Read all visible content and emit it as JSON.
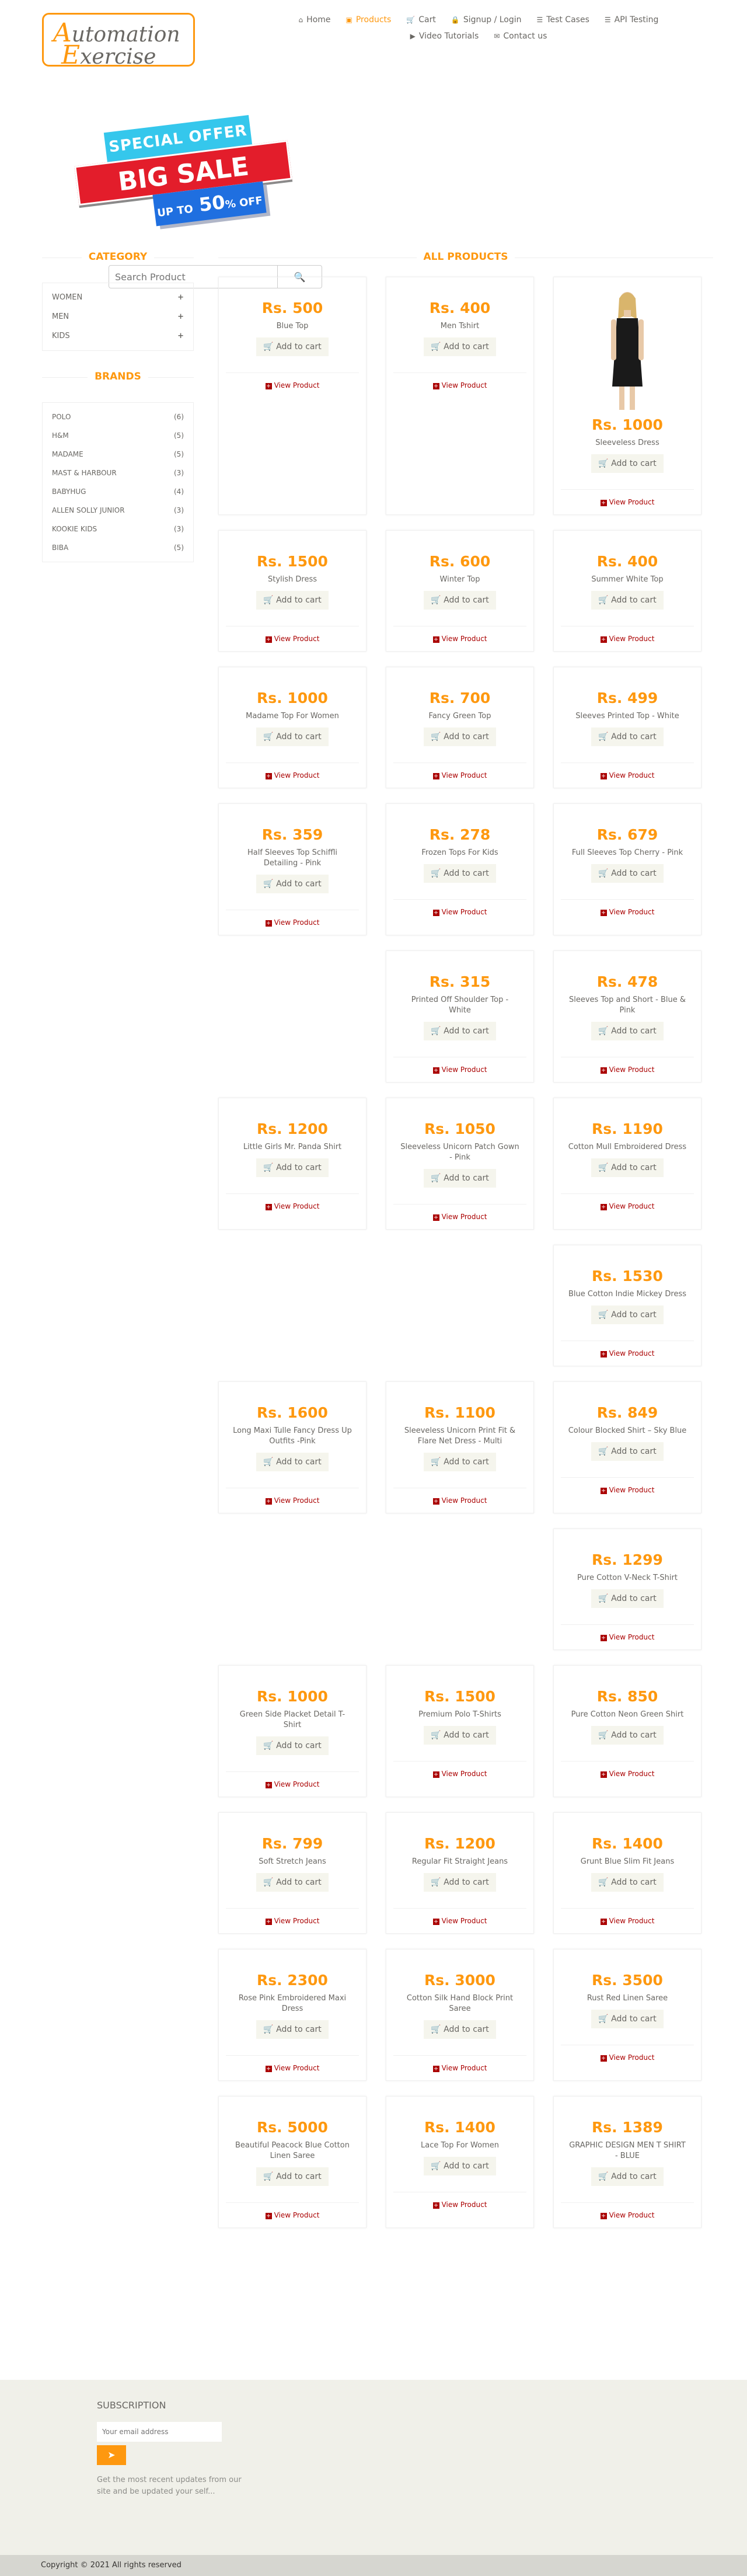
{
  "logo": {
    "word1_cap": "A",
    "word1_rest": "utomation",
    "word2_cap": "E",
    "word2_rest": "xercise"
  },
  "nav": [
    {
      "label": "Home",
      "icon": "home-icon",
      "glyph": "⌂"
    },
    {
      "label": "Products",
      "icon": "products-icon",
      "glyph": "▣",
      "active": true
    },
    {
      "label": "Cart",
      "icon": "cart-icon",
      "glyph": "🛒"
    },
    {
      "label": "Signup / Login",
      "icon": "lock-icon",
      "glyph": "🔒"
    },
    {
      "label": "Test Cases",
      "icon": "list-icon",
      "glyph": "☰"
    },
    {
      "label": "API Testing",
      "icon": "list-icon",
      "glyph": "☰"
    },
    {
      "label": "Video Tutorials",
      "icon": "youtube-icon",
      "glyph": "▶"
    },
    {
      "label": "Contact us",
      "icon": "envelope-icon",
      "glyph": "✉"
    }
  ],
  "banner": {
    "line1": "SPECIAL OFFER",
    "line2": "BIG SALE",
    "line3a": "UP TO",
    "line3b": "50",
    "line3c": "% OFF"
  },
  "search": {
    "placeholder": "Search Product",
    "button_icon": "search-icon"
  },
  "sidebar": {
    "category_title": "CATEGORY",
    "categories": [
      "WOMEN",
      "MEN",
      "KIDS"
    ],
    "brands_title": "BRANDS",
    "brands": [
      {
        "name": "POLO",
        "count": "(6)"
      },
      {
        "name": "H&M",
        "count": "(5)"
      },
      {
        "name": "MADAME",
        "count": "(5)"
      },
      {
        "name": "MAST & HARBOUR",
        "count": "(3)"
      },
      {
        "name": "BABYHUG",
        "count": "(4)"
      },
      {
        "name": "ALLEN SOLLY JUNIOR",
        "count": "(3)"
      },
      {
        "name": "KOOKIE KIDS",
        "count": "(3)"
      },
      {
        "name": "BIBA",
        "count": "(5)"
      }
    ]
  },
  "products_title": "ALL PRODUCTS",
  "add_to_cart": "Add to cart",
  "view_product": "View Product",
  "products": [
    {
      "price": "Rs. 500",
      "name": "Blue Top"
    },
    {
      "price": "Rs. 400",
      "name": "Men Tshirt"
    },
    {
      "price": "Rs. 1000",
      "name": "Sleeveless Dress",
      "image": true
    },
    {
      "price": "Rs. 1500",
      "name": "Stylish Dress"
    },
    {
      "price": "Rs. 600",
      "name": "Winter Top"
    },
    {
      "price": "Rs. 400",
      "name": "Summer White Top"
    },
    {
      "price": "Rs. 1000",
      "name": "Madame Top For Women"
    },
    {
      "price": "Rs. 700",
      "name": "Fancy Green Top"
    },
    {
      "price": "Rs. 499",
      "name": "Sleeves Printed Top - White"
    },
    {
      "price": "Rs. 359",
      "name": "Half Sleeves Top Schiffli Detailing - Pink"
    },
    {
      "price": "Rs. 278",
      "name": "Frozen Tops For Kids"
    },
    {
      "price": "Rs. 679",
      "name": "Full Sleeves Top Cherry - Pink"
    },
    {
      "blank": true
    },
    {
      "price": "Rs. 315",
      "name": "Printed Off Shoulder Top - White"
    },
    {
      "price": "Rs. 478",
      "name": "Sleeves Top and Short - Blue & Pink"
    },
    {
      "price": "Rs. 1200",
      "name": "Little Girls Mr. Panda Shirt"
    },
    {
      "price": "Rs. 1050",
      "name": "Sleeveless Unicorn Patch Gown - Pink"
    },
    {
      "price": "Rs. 1190",
      "name": "Cotton Mull Embroidered Dress"
    },
    {
      "blank": true
    },
    {
      "blank": true
    },
    {
      "price": "Rs. 1530",
      "name": "Blue Cotton Indie Mickey Dress"
    },
    {
      "price": "Rs. 1600",
      "name": "Long Maxi Tulle Fancy Dress Up Outfits -Pink"
    },
    {
      "price": "Rs. 1100",
      "name": "Sleeveless Unicorn Print Fit & Flare Net Dress - Multi"
    },
    {
      "price": "Rs. 849",
      "name": "Colour Blocked Shirt – Sky Blue"
    },
    {
      "blank": true
    },
    {
      "blank": true
    },
    {
      "price": "Rs. 1299",
      "name": "Pure Cotton V-Neck T-Shirt"
    },
    {
      "price": "Rs. 1000",
      "name": "Green Side Placket Detail T-Shirt"
    },
    {
      "price": "Rs. 1500",
      "name": "Premium Polo T-Shirts"
    },
    {
      "price": "Rs. 850",
      "name": "Pure Cotton Neon Green Shirt"
    },
    {
      "price": "Rs. 799",
      "name": "Soft Stretch Jeans"
    },
    {
      "price": "Rs. 1200",
      "name": "Regular Fit Straight Jeans"
    },
    {
      "price": "Rs. 1400",
      "name": "Grunt Blue Slim Fit Jeans"
    },
    {
      "price": "Rs. 2300",
      "name": "Rose Pink Embroidered Maxi Dress"
    },
    {
      "price": "Rs. 3000",
      "name": "Cotton Silk Hand Block Print Saree"
    },
    {
      "price": "Rs. 3500",
      "name": "Rust Red Linen Saree"
    },
    {
      "price": "Rs. 5000",
      "name": "Beautiful Peacock Blue Cotton Linen Saree"
    },
    {
      "price": "Rs. 1400",
      "name": "Lace Top For Women"
    },
    {
      "price": "Rs. 1389",
      "name": "GRAPHIC DESIGN MEN T SHIRT - BLUE"
    }
  ],
  "footer": {
    "subscription_title": "SUBSCRIPTION",
    "email_placeholder": "Your email address",
    "subscribe_icon": "arrow-circle-right-icon",
    "text": "Get the most recent updates from our site and be updated your self...",
    "copyright": "Copyright © 2021 All rights reserved"
  },
  "colors": {
    "accent": "#FE980F",
    "view_link": "#AA0000",
    "footer_bg": "#F0F0E9",
    "bottom_bg": "#D6D6D0"
  }
}
